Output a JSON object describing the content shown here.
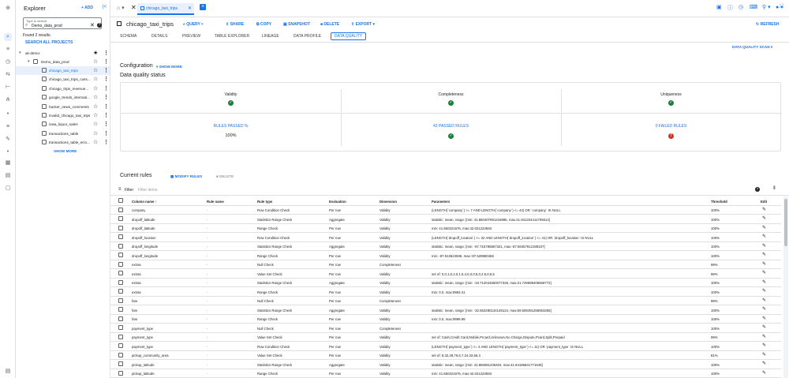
{
  "explorer": {
    "title": "Explorer",
    "add_label": "+ ADD",
    "search_label": "Type to search",
    "search_value": "Demo_data_prod",
    "found": "Found 2 results.",
    "search_all": "SEARCH ALL PROJECTS",
    "project": "ak-demo-",
    "dataset": "Demo_data_prod",
    "tables": [
      "chicago_taxi_trips",
      "chicago_taxi_trips_cuss...",
      "chicago_trips_revenue...",
      "google_trends_internati...",
      "hacker_news_comments",
      "invalid_chicago_taxi_trips",
      "iowa_liquor_sales",
      "transactions_table",
      "transactions_table_erro..."
    ],
    "show_more": "SHOW MORE"
  },
  "topbar": {
    "tab_label": "chicago_taxi_trips"
  },
  "header": {
    "title": "chicago_taxi_trips",
    "actions": [
      "QUERY",
      "SHARE",
      "COPY",
      "SNAPSHOT",
      "DELETE",
      "EXPORT"
    ],
    "refresh": "REFRESH"
  },
  "subtabs": [
    "SCHEMA",
    "DETAILS",
    "PREVIEW",
    "TABLE EXPLORER",
    "LINEAGE",
    "DATA PROFILE",
    "DATA QUALITY"
  ],
  "dq": {
    "scan_button": "DATA QUALITY SCAN",
    "config_title": "Configuration",
    "config_show_more": "SHOW MORE",
    "status_title": "Data quality status",
    "dimensions": [
      "Validity",
      "Completeness",
      "Uniqueness"
    ],
    "summary": [
      {
        "link": "RULES PASSED %",
        "value": "100%"
      },
      {
        "link": "43 PASSED RULES"
      },
      {
        "link": "0 FAILED RULES"
      }
    ]
  },
  "rules": {
    "title": "Current rules",
    "modify": "MODIFY RULES",
    "delete": "DELETE",
    "filter_label": "Filter",
    "filter_placeholder": "Filter items",
    "columns": [
      "Column name",
      "Rule name",
      "Rule type",
      "Evaluation",
      "Dimension",
      "Parameters",
      "Threshold",
      "Edit"
    ],
    "rows": [
      [
        "company",
        "-",
        "Row Condition Check",
        "Per row",
        "Validity",
        "(LENGTH(`company`) >= 7 AND LENGTH(`company`) <= 44) OR `company` IS NULL",
        "100%"
      ],
      [
        "dropoff_latitude",
        "-",
        "Statistics Range Check",
        "Aggregate",
        "Validity",
        "statistic: mean, range: [min: 41.860407091216985, max:41.941344411705614]",
        "100%"
      ],
      [
        "dropoff_latitude",
        "-",
        "Range Check",
        "Per row",
        "Validity",
        "min: 41.650221676, max:42.021223593",
        "100%"
      ],
      [
        "dropoff_location",
        "-",
        "Row Condition Check",
        "Per row",
        "Validity",
        "(LENGTH(`dropoff_location`) >= 32 AND LENGTH(`dropoff_location`) <= 41) OR `dropoff_location` IS NULL",
        "100%"
      ],
      [
        "dropoff_longitude",
        "-",
        "Statistics Range Check",
        "Aggregate",
        "Validity",
        "statistic: mean, range: [min: -87.715785867321, max:-87.59457912188107]",
        "100%"
      ],
      [
        "dropoff_longitude",
        "-",
        "Range Check",
        "Per row",
        "Validity",
        "min: -87.913624596, max:-87.529950466",
        "100%"
      ],
      [
        "extras",
        "-",
        "Null Check",
        "Per row",
        "Completeness",
        "",
        "99%"
      ],
      [
        "extras",
        "-",
        "Value Set Check",
        "Per row",
        "Validity",
        "set of: 0,0,1,0,2,0,1.5,4,0,3,0,5,0,2.5,0,5.5",
        "98%"
      ],
      [
        "extras",
        "-",
        "Statistics Range Check",
        "Aggregate",
        "Validity",
        "statistic: mean, range: [min: -19.712044550077326, max:21.749698406568772]",
        "100%"
      ],
      [
        "extras",
        "-",
        "Range Check",
        "Per row",
        "Validity",
        "min: 0.0, max:9993.41",
        "100%"
      ],
      [
        "fare",
        "-",
        "Null Check",
        "Per row",
        "Completeness",
        "",
        "99%"
      ],
      [
        "fare",
        "-",
        "Statistics Range Check",
        "Aggregate",
        "Validity",
        "statistic: mean, range: [min: -32.563280134149124, max:59.608491255063256]",
        "100%"
      ],
      [
        "fare",
        "-",
        "Range Check",
        "Per row",
        "Validity",
        "min: 0.0, max:9999.99",
        "100%"
      ],
      [
        "payment_type",
        "-",
        "Null Check",
        "Per row",
        "Completeness",
        "",
        "100%"
      ],
      [
        "payment_type",
        "-",
        "Value Set Check",
        "Per row",
        "Validity",
        "set of: Cash,Credit Card,Mobile,Prcard,Unknown,No Charge,Dispute,Pcard,Split,Prepaid",
        "99%"
      ],
      [
        "payment_type",
        "-",
        "Row Condition Check",
        "Per row",
        "Validity",
        "(LENGTH(`payment_type`) >= 4 AND LENGTH(`payment_type`) <= 11) OR `payment_type` IS NULL",
        "100%"
      ],
      [
        "pickup_community_area",
        "-",
        "Value Set Check",
        "Per row",
        "Validity",
        "set of: 8,32,28,76,6,7,24,33,56,3",
        "81%"
      ],
      [
        "pickup_latitude",
        "-",
        "Statistics Range Check",
        "Aggregate",
        "Validity",
        "statistic: mean, range: [min: 41.866081236404, max:41.94186841771649]",
        "100%"
      ],
      [
        "pickup_latitude",
        "-",
        "Range Check",
        "Per row",
        "Validity",
        "min: 41.650221676, max:42.021223593",
        "100%"
      ]
    ]
  }
}
